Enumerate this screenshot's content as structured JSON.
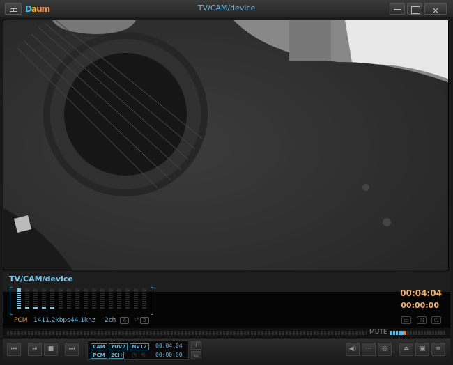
{
  "titlebar": {
    "title": "TV/CAM/device",
    "logo": {
      "part1": "D",
      "part2": "a",
      "part3": "um"
    },
    "buttons": {
      "menu": "menu-icon",
      "minimize": "minimize-icon",
      "maximize": "maximize-icon",
      "close": "✕"
    }
  },
  "video": {
    "description": "Webcam feed showing acoustic guitar body and soundhole in grayscale"
  },
  "panel": {
    "source_title": "TV/CAM/device",
    "equalizer": {
      "bands": 16,
      "levels": [
        10,
        1,
        1,
        1,
        1,
        0,
        0,
        0,
        0,
        0,
        0,
        0,
        0,
        0,
        0,
        0
      ],
      "max_level": 10
    },
    "audio_codec": "PCM",
    "bitrate": "1411.2kbps",
    "sample_rate": "44.1khz",
    "channels": "2ch",
    "a_label": "A",
    "swap_icon": "⇄",
    "b_label": "B",
    "time_total": "00:04:04",
    "time_current": "00:00:00",
    "side_buttons": [
      "subtitle-icon",
      "shuffle-icon",
      "power-icon"
    ]
  },
  "seekbar": {
    "mute_label": "MUTE",
    "volume_level": 0.75,
    "colors": {
      "volume": "#6ab4e0",
      "volume_marker": "#e08030"
    }
  },
  "controls": {
    "prev": "⏮",
    "play_pause": "⏯",
    "stop": "■",
    "next": "⏭",
    "tags_row1": [
      "CAM",
      "YUV2",
      "NV12"
    ],
    "tags_row2": [
      "PCM",
      "2CH"
    ],
    "lcd_time_total": "00:04:04",
    "lcd_time_current": "00:00:00",
    "info_label": "i",
    "right_buttons": [
      "volume-icon",
      "subtitle-icon",
      "record-icon",
      "eject-icon",
      "capture-icon",
      "playlist-icon"
    ]
  },
  "colors": {
    "accent": "#6ab4e0",
    "time": "#f0b070",
    "codec": "#e0a060"
  }
}
